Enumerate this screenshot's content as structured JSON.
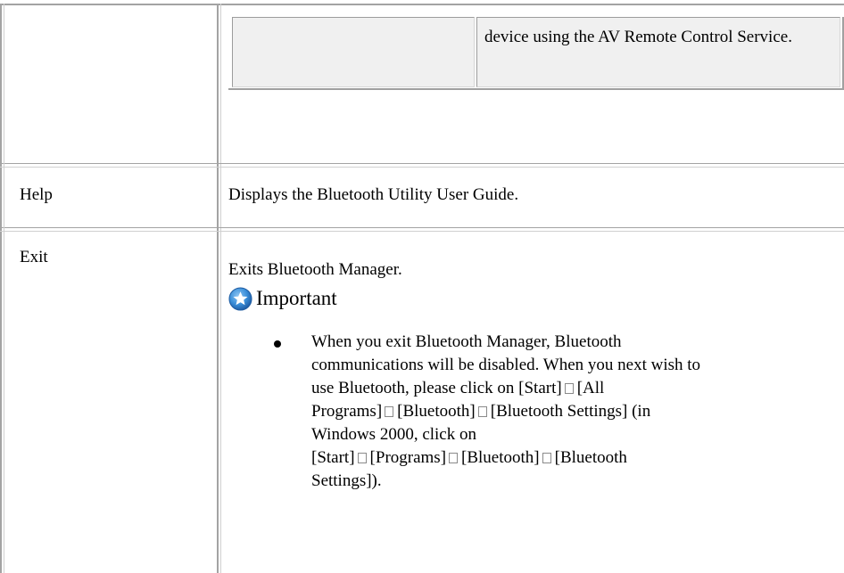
{
  "table": {
    "rows": [
      {
        "label": "",
        "nested": {
          "cells": [
            "",
            "device using the AV Remote Control Service."
          ]
        }
      },
      {
        "label": "Help",
        "description": "Displays the Bluetooth Utility User Guide."
      },
      {
        "label": "Exit",
        "description": "Exits Bluetooth Manager.",
        "important": {
          "icon": "important-star-icon",
          "title": "Important",
          "bullets": [
            {
              "lines": [
                "When you exit Bluetooth Manager, Bluetooth",
                "communications will be disabled. When you next wish to",
                "use Bluetooth, please click on [Start]",
                "[All",
                "Programs]",
                "[Bluetooth]",
                "[Bluetooth Settings] (in",
                "Windows 2000, click on",
                "[Start]",
                "[Programs]",
                "[Bluetooth]",
                "[Bluetooth",
                "Settings])."
              ]
            }
          ]
        }
      }
    ]
  },
  "colors": {
    "grid": "#a3a3a3",
    "nested_bg": "#f0f0f0",
    "icon_blue": "#3b8fd9"
  }
}
